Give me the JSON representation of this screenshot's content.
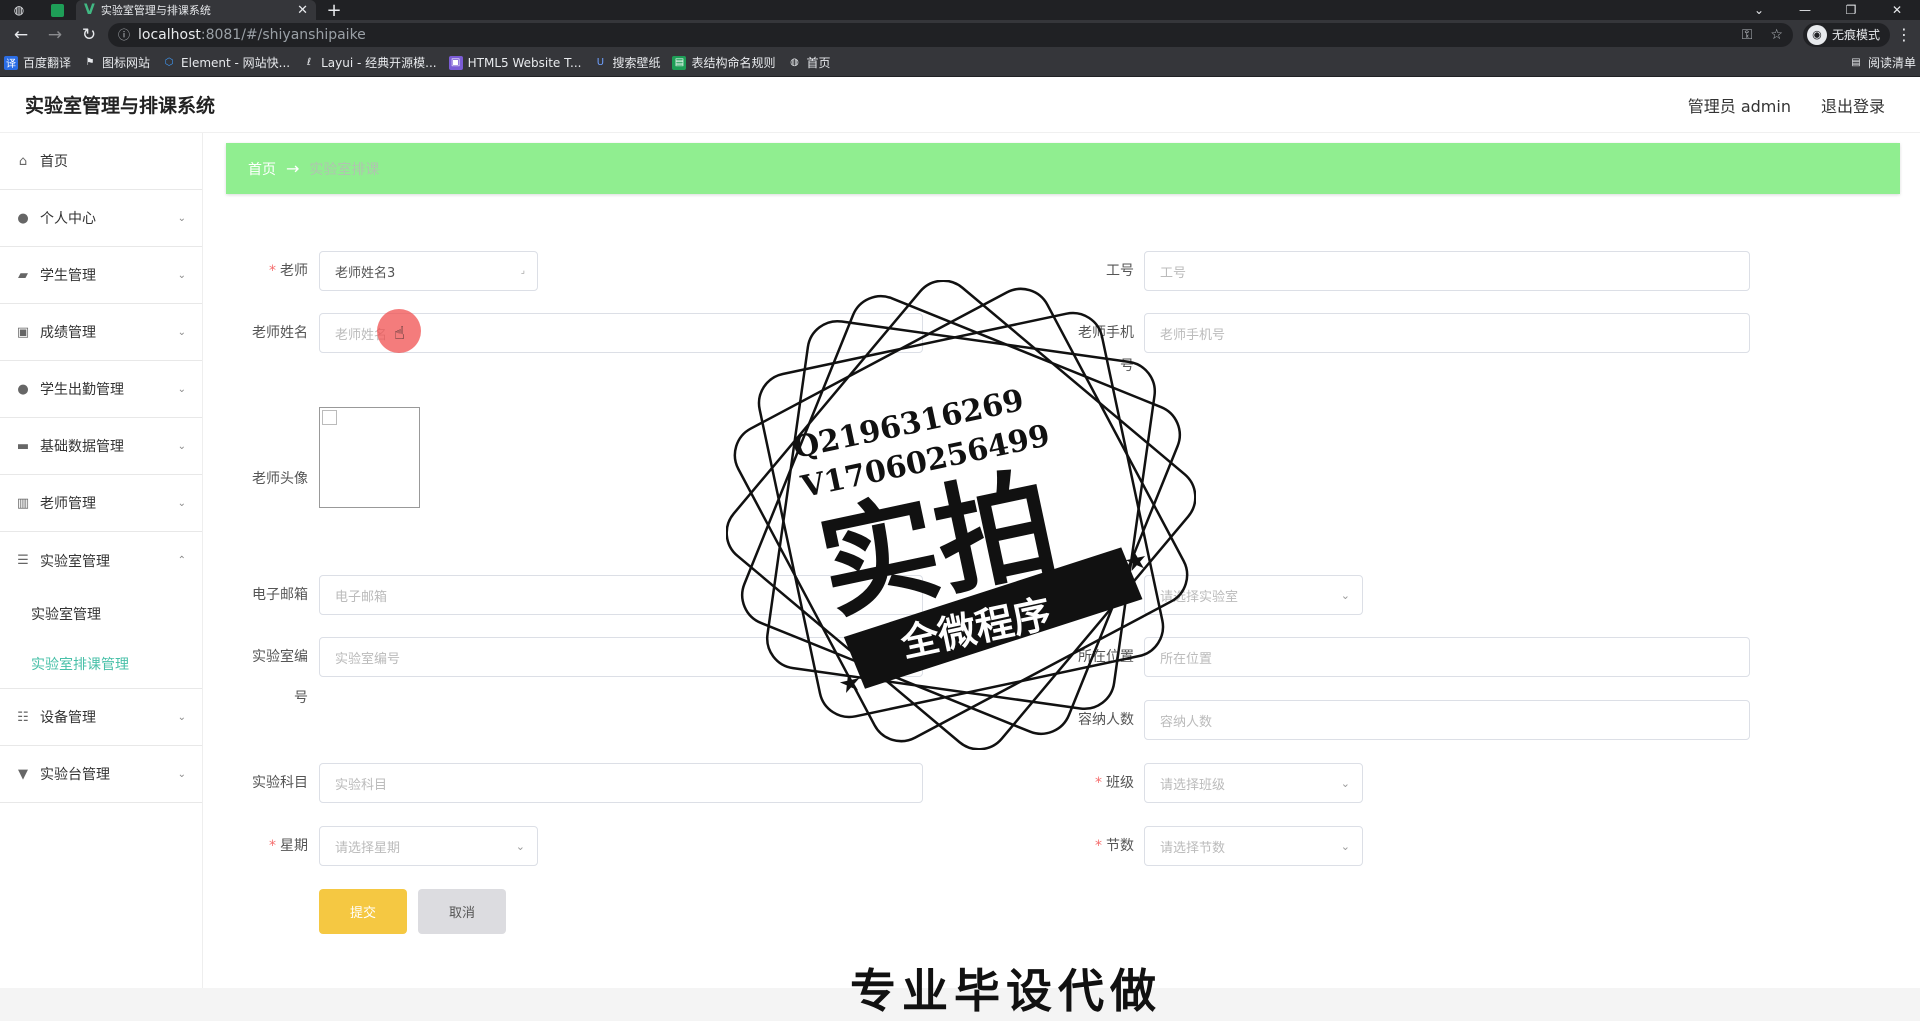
{
  "browser": {
    "tab_title": "实验室管理与排课系统",
    "url_host": "localhost",
    "url_path": ":8081/#/shiyanshipaike",
    "incognito_label": "无痕模式",
    "reading_list": "阅读清单",
    "bookmarks": [
      {
        "label": "百度翻译",
        "icon": "translate-icon",
        "color": "#2b6de5"
      },
      {
        "label": "图标网站",
        "icon": "flag-icon",
        "color": "#444444"
      },
      {
        "label": "Element - 网站快...",
        "icon": "element-icon",
        "color": "#409eff"
      },
      {
        "label": "Layui - 经典开源模...",
        "icon": "layui-icon",
        "color": "#555555"
      },
      {
        "label": "HTML5 Website T...",
        "icon": "html5-icon",
        "color": "#7b5cd6"
      },
      {
        "label": "搜索壁纸",
        "icon": "wallpaper-icon",
        "color": "#3b6fd9"
      },
      {
        "label": "表结构命名规则",
        "icon": "table-icon",
        "color": "#1e9e57"
      },
      {
        "label": "首页",
        "icon": "globe-icon",
        "color": "#888888"
      }
    ]
  },
  "header": {
    "title": "实验室管理与排课系统",
    "user": "管理员 admin",
    "logout": "退出登录"
  },
  "sidebar": {
    "items": [
      {
        "label": "首页",
        "icon": "home-icon"
      },
      {
        "label": "个人中心",
        "icon": "user-icon"
      },
      {
        "label": "学生管理",
        "icon": "student-icon"
      },
      {
        "label": "成绩管理",
        "icon": "grade-icon"
      },
      {
        "label": "学生出勤管理",
        "icon": "attendance-icon"
      },
      {
        "label": "基础数据管理",
        "icon": "database-icon"
      },
      {
        "label": "老师管理",
        "icon": "teacher-icon"
      },
      {
        "label": "实验室管理",
        "icon": "list-icon"
      },
      {
        "label": "设备管理",
        "icon": "sliders-icon"
      },
      {
        "label": "实验台管理",
        "icon": "bench-icon"
      }
    ],
    "sub_items": [
      "实验室管理",
      "实验室排课管理"
    ]
  },
  "breadcrumb": {
    "home": "首页",
    "arrow": "→",
    "current": "实验室排课"
  },
  "form": {
    "teacher_label": "老师",
    "teacher_value": "老师姓名3",
    "job_no_label": "工号",
    "job_no_placeholder": "工号",
    "teacher_name_label": "老师姓名",
    "teacher_name_placeholder": "老师姓名",
    "teacher_phone_label": "老师手机",
    "teacher_phone_label_2": "号",
    "teacher_phone_placeholder": "老师手机号",
    "avatar_label": "老师头像",
    "email_label": "电子邮箱",
    "email_placeholder": "电子邮箱",
    "lab_label": "实验室",
    "lab_placeholder": "请选择实验室",
    "lab_no_label": "实验室编",
    "lab_no_label_2": "号",
    "lab_no_placeholder": "实验室编号",
    "location_label": "所在位置",
    "location_placeholder": "所在位置",
    "capacity_label": "容纳人数",
    "capacity_placeholder": "容纳人数",
    "subject_label": "实验科目",
    "subject_placeholder": "实验科目",
    "class_label": "班级",
    "class_placeholder": "请选择班级",
    "week_label": "星期",
    "week_placeholder": "请选择星期",
    "period_label": "节数",
    "period_placeholder": "请选择节数",
    "submit": "提交",
    "cancel": "取消"
  },
  "watermark": {
    "line1": "Q2196316269",
    "line2": "V17060256499",
    "big": "实拍",
    "ribbon": "全微程序",
    "bottom": "专业毕设代做"
  }
}
